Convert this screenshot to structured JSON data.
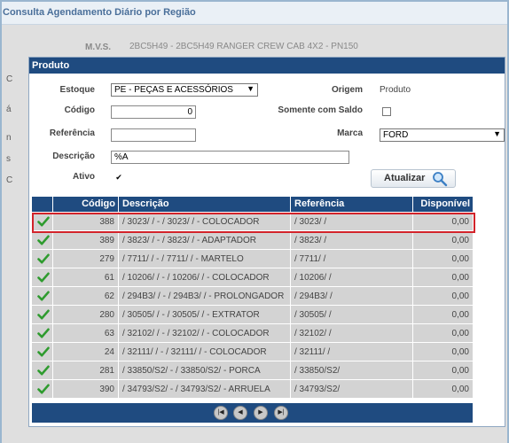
{
  "page": {
    "title": "Consulta Agendamento Diário por Região"
  },
  "background": {
    "mvs_label": "M.V.S.",
    "mvs_value": "2BC5H49 - 2BC5H49 RANGER CREW CAB 4X2 - PN150",
    "fragments": [
      "C",
      "á",
      "n",
      "s",
      "C"
    ]
  },
  "dialog": {
    "title": "Produto",
    "form": {
      "estoque_label": "Estoque",
      "estoque_value": "PE - PEÇAS E ACESSÓRIOS",
      "origem_label": "Origem",
      "origem_value": "Produto",
      "codigo_label": "Código",
      "codigo_value": "0",
      "somente_saldo_label": "Somente com Saldo",
      "referencia_label": "Referência",
      "referencia_value": "",
      "marca_label": "Marca",
      "marca_value": "FORD",
      "descricao_label": "Descrição",
      "descricao_value": "%A",
      "ativo_label": "Ativo"
    },
    "refresh_button": "Atualizar",
    "table": {
      "headers": [
        "",
        "Código",
        "Descrição",
        "Referência",
        "Disponível"
      ],
      "rows": [
        {
          "codigo": "388",
          "descricao": "/ 3023/ / - / 3023/ / - COLOCADOR",
          "referencia": "/ 3023/ /",
          "disponivel": "0,00"
        },
        {
          "codigo": "389",
          "descricao": "/ 3823/ / - / 3823/ / - ADAPTADOR",
          "referencia": "/ 3823/ /",
          "disponivel": "0,00"
        },
        {
          "codigo": "279",
          "descricao": "/ 7711/ / - / 7711/ / - MARTELO",
          "referencia": "/ 7711/ /",
          "disponivel": "0,00"
        },
        {
          "codigo": "61",
          "descricao": "/ 10206/ / - / 10206/ / - COLOCADOR",
          "referencia": "/ 10206/ /",
          "disponivel": "0,00"
        },
        {
          "codigo": "62",
          "descricao": "/ 294B3/ / - / 294B3/ / - PROLONGADOR",
          "referencia": "/ 294B3/ /",
          "disponivel": "0,00"
        },
        {
          "codigo": "280",
          "descricao": "/ 30505/ / - / 30505/ / - EXTRATOR",
          "referencia": "/ 30505/ /",
          "disponivel": "0,00"
        },
        {
          "codigo": "63",
          "descricao": "/ 32102/ / - / 32102/ / - COLOCADOR",
          "referencia": "/ 32102/ /",
          "disponivel": "0,00"
        },
        {
          "codigo": "24",
          "descricao": "/ 32111/ / - / 32111/ / - COLOCADOR",
          "referencia": "/ 32111/ /",
          "disponivel": "0,00"
        },
        {
          "codigo": "281",
          "descricao": "/ 33850/S2/ - / 33850/S2/ - PORCA",
          "referencia": "/ 33850/S2/",
          "disponivel": "0,00"
        },
        {
          "codigo": "390",
          "descricao": "/ 34793/S2/ - / 34793/S2/ - ARRUELA",
          "referencia": "/ 34793/S2/",
          "disponivel": "0,00"
        }
      ]
    },
    "pager": {
      "first": "|◀",
      "prev": "◀",
      "next": "▶",
      "last": "▶|"
    }
  },
  "colors": {
    "header_blue": "#1f4b80",
    "highlight_red": "#d2232a",
    "check_green": "#2e9b2e"
  },
  "icons": {
    "row_check": "check-icon",
    "refresh": "magnifier-icon"
  }
}
